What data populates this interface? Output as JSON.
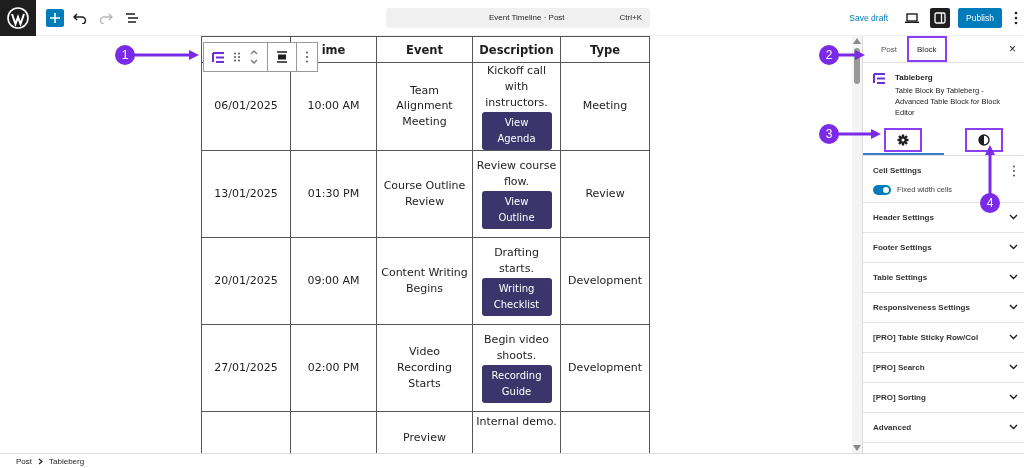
{
  "topbar": {
    "tools": [
      {
        "kind": "add",
        "disabled": false
      },
      {
        "kind": "undo",
        "disabled": false
      },
      {
        "kind": "redo",
        "disabled": true
      },
      {
        "kind": "list",
        "disabled": false
      }
    ],
    "command": {
      "title": "Event Timeline · Post",
      "shortcut": "Ctrl+K"
    },
    "save_draft": "Save draft",
    "settings_on": true,
    "publish": "Publish"
  },
  "table": {
    "columns": [
      {},
      {
        "label": "ime"
      },
      {
        "label": "Event"
      },
      {
        "label": "Description"
      },
      {
        "label": "Type"
      }
    ],
    "rows": [
      {
        "date": "06/01/2025",
        "time": "10:00 AM",
        "event": "Team Alignment Meeting",
        "description": "Kickoff call with instructors.",
        "button": "View Agenda",
        "type": "Meeting"
      },
      {
        "date": "13/01/2025",
        "time": "01:30 PM",
        "event": "Course Outline Review",
        "description": "Review course flow.",
        "button": "View Outline",
        "type": "Review"
      },
      {
        "date": "20/01/2025",
        "time": "09:00 AM",
        "event": "Content Writing Begins",
        "description": "Drafting starts.",
        "button": "Writing Checklist",
        "type": "Development"
      },
      {
        "date": "27/01/2025",
        "time": "02:00 PM",
        "event": "Video Recording Starts",
        "description": "Begin video shoots.",
        "button": "Recording Guide",
        "type": "Development"
      },
      {
        "event": "Preview",
        "description": "Internal demo."
      }
    ]
  },
  "sidebar": {
    "tabs": [
      {
        "label": "Post",
        "selected": false,
        "highlighted": false
      },
      {
        "label": "Block",
        "selected": true,
        "highlighted": true
      }
    ],
    "close": "×",
    "block": {
      "name": "Tableberg",
      "description": "Table Block By Tableberg - Advanced Table Block for Block Editor"
    },
    "icon_tabs": [
      {
        "kind": "settings",
        "selected": true,
        "highlighted": true
      },
      {
        "kind": "styles",
        "selected": false,
        "highlighted": true
      }
    ],
    "cell_settings": {
      "title": "Cell Settings",
      "toggle": {
        "label": "Fixed width cells",
        "on": true
      }
    },
    "panels": [
      {
        "title": "Header Settings",
        "expanded": false
      },
      {
        "title": "Footer Settings",
        "expanded": false
      },
      {
        "title": "Table Settings",
        "expanded": false
      },
      {
        "title": "Responsiveness Settings",
        "expanded": false
      },
      {
        "title": "[PRO] Table Sticky Row/Col",
        "expanded": false
      },
      {
        "title": "[PRO] Search",
        "expanded": false
      },
      {
        "title": "[PRO] Sorting",
        "expanded": false
      },
      {
        "title": "Advanced",
        "expanded": false
      }
    ]
  },
  "breadcrumb": [
    "Post",
    "Tableberg"
  ],
  "callouts": [
    "1",
    "2",
    "3",
    "4"
  ]
}
